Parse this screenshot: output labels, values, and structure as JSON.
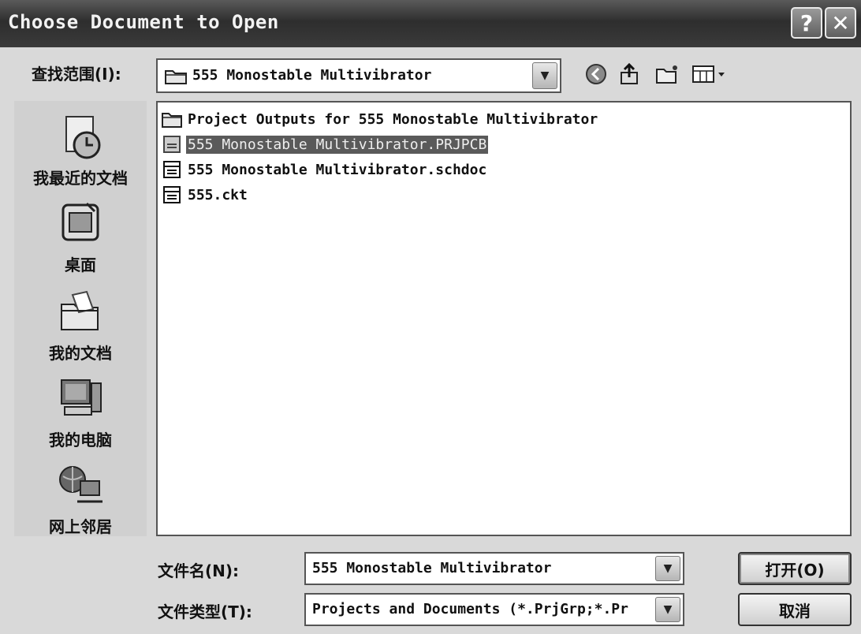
{
  "window": {
    "title": "Choose Document to Open",
    "help_label": "?",
    "close_label": "✕"
  },
  "look_in": {
    "label": "查找范围(I):",
    "value": "555 Monostable Multivibrator"
  },
  "places": [
    {
      "label": "我最近的文档",
      "icon": "recent-documents-icon"
    },
    {
      "label": "桌面",
      "icon": "desktop-icon"
    },
    {
      "label": "我的文档",
      "icon": "my-documents-icon"
    },
    {
      "label": "我的电脑",
      "icon": "my-computer-icon"
    },
    {
      "label": "网上邻居",
      "icon": "network-places-icon"
    }
  ],
  "files": [
    {
      "name": "Project Outputs for 555 Monostable Multivibrator",
      "type": "folder",
      "selected": false
    },
    {
      "name": "555 Monostable Multivibrator.PRJPCB",
      "type": "file",
      "selected": true
    },
    {
      "name": "555 Monostable Multivibrator.schdoc",
      "type": "file",
      "selected": false
    },
    {
      "name": "555.ckt",
      "type": "file",
      "selected": false
    }
  ],
  "file_name": {
    "label": "文件名(N):",
    "value": "555 Monostable Multivibrator"
  },
  "file_type": {
    "label": "文件类型(T):",
    "value": "Projects and Documents (*.PrjGrp;*.Pr"
  },
  "buttons": {
    "open_label": "打开(O)",
    "cancel_label": "取消"
  }
}
